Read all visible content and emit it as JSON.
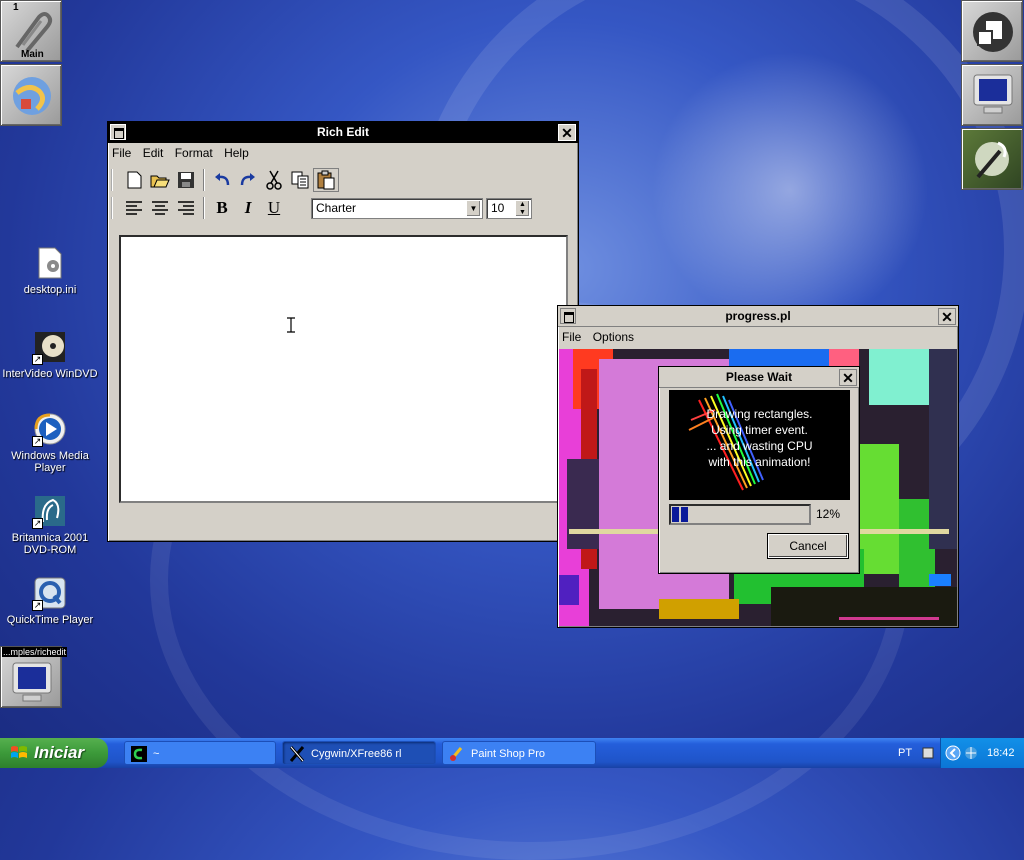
{
  "dock": {
    "workspace_number": "1",
    "workspace_label": "Main",
    "miniwindow_label": "...mples/richedit"
  },
  "desktop_icons": [
    {
      "label": "desktop.ini",
      "icon": "ini-file-icon"
    },
    {
      "label": "InterVideo WinDVD",
      "icon": "windvd-icon"
    },
    {
      "label": "Windows Media Player",
      "icon": "media-player-icon"
    },
    {
      "label": "Britannica 2001 DVD-ROM",
      "icon": "britannica-icon"
    },
    {
      "label": "QuickTime Player",
      "icon": "quicktime-icon"
    }
  ],
  "rich_edit": {
    "title": "Rich Edit",
    "menu": [
      "File",
      "Edit",
      "Format",
      "Help"
    ],
    "toolbar1": [
      "new-icon",
      "open-icon",
      "save-icon",
      "undo-icon",
      "redo-icon",
      "cut-icon",
      "copy-icon",
      "paste-icon"
    ],
    "toolbar2": {
      "align": [
        "align-left-icon",
        "align-center-icon",
        "align-right-icon"
      ],
      "bold": "B",
      "italic": "I",
      "underline": "U",
      "font": "Charter",
      "size": "10"
    },
    "text": ""
  },
  "progress_window": {
    "title": "progress.pl",
    "menu": [
      "File",
      "Options"
    ]
  },
  "please_wait": {
    "title": "Please Wait",
    "lines": [
      "Drawing rectangles.",
      "Using timer event.",
      "... and wasting CPU",
      "with this animation!"
    ],
    "progress_fraction": 0.12,
    "percent_label": "12%",
    "cancel": "Cancel"
  },
  "taskbar": {
    "start_label": "Iniciar",
    "tasks": [
      {
        "label": "~",
        "icon": "cygwin-icon"
      },
      {
        "label": "Cygwin/XFree86 rl",
        "icon": "x-icon"
      },
      {
        "label": "Paint Shop Pro",
        "icon": "paint-shop-pro-icon"
      }
    ],
    "language": "PT",
    "clock": "18:42"
  },
  "colors": {
    "accent": "#245edb",
    "start_green": "#3c9a3a",
    "progress_blue": "#0a1a9a"
  }
}
